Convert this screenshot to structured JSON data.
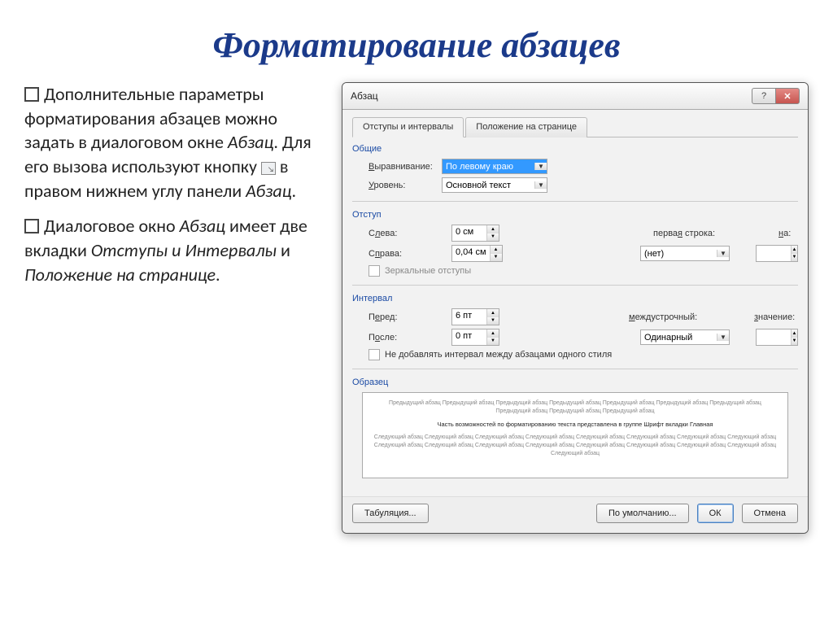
{
  "title": "Форматирование абзацев",
  "bullets": {
    "b1_part1": "Дополнительные параметры форматирования абзацев можно задать в диалоговом окне ",
    "b1_italic1": "Абзац",
    "b1_part2": ". Для его вызова используют кнопку ",
    "b1_part3": " в правом нижнем углу панели ",
    "b1_italic2": "Абзац",
    "b1_part4": ".",
    "b2_part1": "Диалоговое окно ",
    "b2_italic1": "Абзац",
    "b2_part2": " имеет две вкладки ",
    "b2_italic2": "Отступы и Интервалы",
    "b2_part3": " и ",
    "b2_italic3": "Положение на странице",
    "b2_part4": "."
  },
  "dialog": {
    "title": "Абзац",
    "help": "?",
    "close": "✕",
    "tabs": {
      "tab1": "Отступы и интервалы",
      "tab2": "Положение на странице"
    },
    "sections": {
      "general": "Общие",
      "indent": "Отступ",
      "spacing": "Интервал",
      "preview": "Образец"
    },
    "fields": {
      "alignment_label": "Выравнивание:",
      "alignment_value": "По левому краю",
      "level_label": "Уровень:",
      "level_value": "Основной текст",
      "left_label": "Слева:",
      "left_value": "0 см",
      "right_label": "Справа:",
      "right_value": "0,04 см",
      "firstline_label": "первая строка:",
      "firstline_value": "(нет)",
      "on_label": "на:",
      "mirror_label": "Зеркальные отступы",
      "before_label": "Перед:",
      "before_value": "6 пт",
      "after_label": "После:",
      "after_value": "0 пт",
      "linespacing_label": "междустрочный:",
      "linespacing_value": "Одинарный",
      "value_label": "значение:",
      "noadd_label": "Не добавлять интервал между абзацами одного стиля"
    },
    "preview": {
      "prev": "Предыдущий абзац Предыдущий абзац Предыдущий абзац Предыдущий абзац Предыдущий абзац Предыдущий абзац Предыдущий абзац Предыдущий абзац Предыдущий абзац Предыдущий абзац",
      "main": "Часть возможностей по форматированию текста представлена в группе Шрифт вкладки Главная",
      "next": "Следующий абзац Следующий абзац Следующий абзац Следующий абзац Следующий абзац Следующий абзац Следующий абзац Следующий абзац Следующий абзац Следующий абзац Следующий абзац Следующий абзац Следующий абзац Следующий абзац Следующий абзац Следующий абзац Следующий абзац"
    },
    "buttons": {
      "tabs": "Табуляция...",
      "default": "По умолчанию...",
      "ok": "ОК",
      "cancel": "Отмена"
    }
  }
}
